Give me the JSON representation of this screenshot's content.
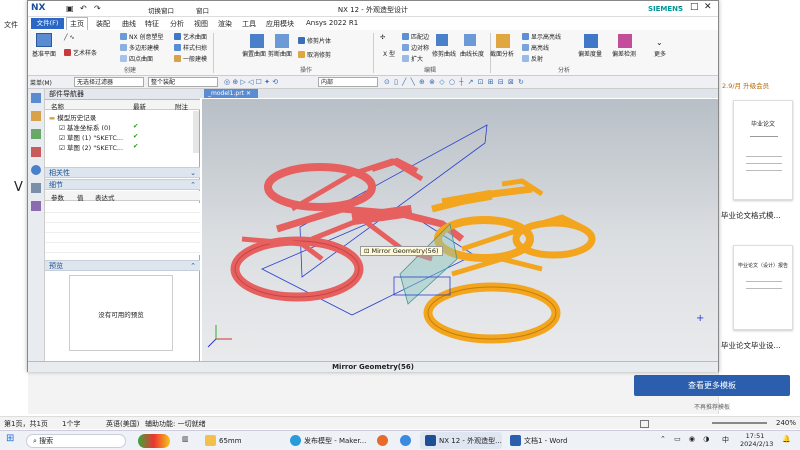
{
  "word": {
    "left_labels": [
      "文件",
      "V"
    ],
    "panel": {
      "top_text": "2.9/月  升级会员",
      "doc1_caption": "毕业论文格式模...",
      "doc2_caption": "毕业论文毕业设...",
      "doc1_title": "毕业论文",
      "doc2_title": "毕业论文（设计）报告",
      "more_button": "查看更多模板",
      "no_recommend": "不再推荐模板"
    },
    "status": {
      "page": "第1页，共1页",
      "words": "1个字",
      "lang": "英语(美国)",
      "access": "辅助功能: 一切就绪",
      "zoom": "240%"
    }
  },
  "nx": {
    "title": "NX 12 - 外观造型设计",
    "brand": "SIEMENS",
    "logo": "NX",
    "quick": {
      "switch": "切换窗口",
      "window": "窗口"
    },
    "menu": [
      "文件(F)",
      "主页",
      "装配",
      "曲线",
      "特征",
      "分析",
      "视图",
      "渲染",
      "工具",
      "应用模块",
      "Ansys 2022 R1"
    ],
    "ribbon": {
      "sketch": "基准平面",
      "art": "艺术样条",
      "group_create": "创建",
      "items_create": [
        "NX 创意塑型",
        "多边形建模",
        "四点曲面",
        "艺术曲面",
        "样式扫掠",
        "一般建模"
      ],
      "items_surface": [
        "偏置曲面",
        "剪断曲面",
        "修剪片体",
        "取消修剪"
      ],
      "group_operate": "操作",
      "items_edit": [
        "X 型",
        "匹配边",
        "边对称",
        "扩大",
        "修剪曲线",
        "曲线长度"
      ],
      "group_edit": "编辑",
      "items_analysis": [
        "截面分析",
        "显示高亮线",
        "高亮线",
        "反射",
        "偏差度量",
        "偏差检测",
        "更多"
      ],
      "group_analysis": "分析"
    },
    "filter": {
      "menu": "菜单(M)",
      "filter": "无选择过滤器",
      "assembly": "整个装配",
      "inside": "内部"
    },
    "nav": {
      "title": "部件导航器",
      "columns": [
        "名称",
        "最新",
        "附注"
      ],
      "tree": [
        "模型历史记录",
        "基准坐标系 (0)",
        "草图 (1) \"SKETC...",
        "草图 (2) \"SKETC..."
      ],
      "relevance": "相关性",
      "details": "细节",
      "detail_cols": [
        "参数",
        "值",
        "表达式"
      ],
      "preview": "预览",
      "no_preview": "没有可用的预览"
    },
    "tab": "_model1.prt",
    "tooltip": "Mirror Geometry(56)",
    "status": "Mirror Geometry(56)"
  },
  "taskbar": {
    "search": "搜索",
    "apps": [
      "65mm",
      "发布模型 - Maker...",
      "NX 12 - 外观造型...",
      "文档1 - Word"
    ],
    "ime": "中",
    "time": "17:51",
    "date": "2024/2/13"
  },
  "colors": {
    "orange": "#f3a51e",
    "red": "#e5605f",
    "accent": "#2b67c4",
    "word_btn": "#2b5fad"
  }
}
